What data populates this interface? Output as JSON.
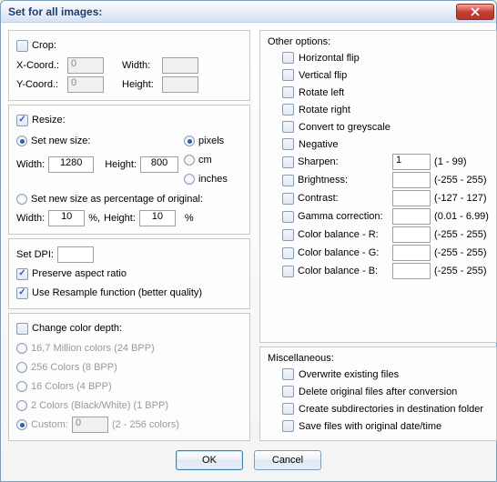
{
  "title": "Set for all images:",
  "crop": {
    "header": "Crop:",
    "xcoord_label": "X-Coord.:",
    "xcoord_val": "0",
    "ycoord_label": "Y-Coord.:",
    "ycoord_val": "0",
    "width_label": "Width:",
    "width_val": "",
    "height_label": "Height:",
    "height_val": ""
  },
  "resize": {
    "header": "Resize:",
    "set_new_size": "Set new size:",
    "width_label": "Width:",
    "width_val": "1280",
    "height_label": "Height:",
    "height_val": "800",
    "unit_pixels": "pixels",
    "unit_cm": "cm",
    "unit_inches": "inches",
    "set_pct_label": "Set new size as percentage of original:",
    "pct_width_label": "Width:",
    "pct_width_val": "10",
    "pct_sep": "%, ",
    "pct_height_label": "Height:",
    "pct_height_val": "10",
    "pct_suffix": "%"
  },
  "dpi": {
    "set_dpi_label": "Set DPI:",
    "dpi_val": "",
    "preserve_label": "Preserve aspect ratio",
    "resample_label": "Use Resample function (better quality)"
  },
  "depth": {
    "header": "Change color depth:",
    "opt_167m": "16,7 Million colors (24 BPP)",
    "opt_256": "256 Colors (8 BPP)",
    "opt_16": "16 Colors (4 BPP)",
    "opt_2": "2 Colors (Black/White) (1 BPP)",
    "opt_custom": "Custom:",
    "custom_val": "0",
    "custom_range": "(2 - 256 colors)"
  },
  "other": {
    "header": "Other options:",
    "hflip": "Horizontal flip",
    "vflip": "Vertical flip",
    "rotleft": "Rotate left",
    "rotright": "Rotate right",
    "grey": "Convert to greyscale",
    "negative": "Negative",
    "sharpen_label": "Sharpen:",
    "sharpen_val": "1",
    "sharpen_range": "(1  -  99)",
    "brightness_label": "Brightness:",
    "brightness_val": "",
    "brightness_range": "(-255  -  255)",
    "contrast_label": "Contrast:",
    "contrast_val": "",
    "contrast_range": "(-127  -  127)",
    "gamma_label": "Gamma correction:",
    "gamma_val": "",
    "gamma_range": "(0.01  -  6.99)",
    "cbr_label": "Color balance - R:",
    "cbr_val": "",
    "cbr_range": "(-255  -  255)",
    "cbg_label": "Color balance - G:",
    "cbg_val": "",
    "cbg_range": "(-255  -  255)",
    "cbb_label": "Color balance - B:",
    "cbb_val": "",
    "cbb_range": "(-255  -  255)"
  },
  "misc": {
    "header": "Miscellaneous:",
    "overwrite": "Overwrite existing files",
    "delete_orig": "Delete original files after conversion",
    "subdirs": "Create subdirectories in destination folder",
    "savedate": "Save files with original date/time"
  },
  "buttons": {
    "ok": "OK",
    "cancel": "Cancel"
  }
}
